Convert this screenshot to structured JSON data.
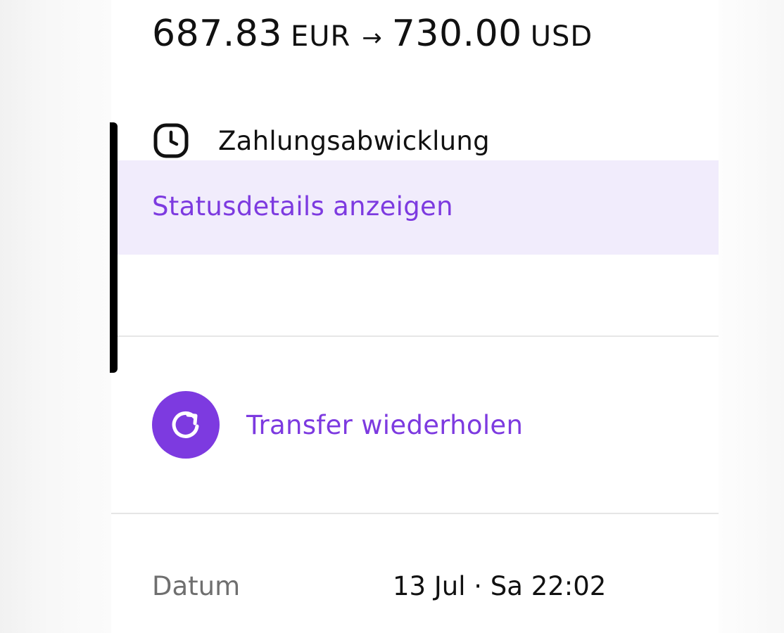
{
  "transfer": {
    "source_amount": "687.83",
    "source_currency": "EUR",
    "arrow": "→",
    "target_amount": "730.00",
    "target_currency": "USD"
  },
  "status": {
    "icon": "clock-icon",
    "label": "Zahlungsabwicklung",
    "details_link": "Statusdetails anzeigen"
  },
  "actions": {
    "repeat_icon": "refresh-icon",
    "repeat_label": "Transfer wiederholen"
  },
  "details": {
    "date_label": "Datum",
    "date_value": "13 Jul · Sa 22:02"
  },
  "colors": {
    "accent": "#7d3ae0",
    "highlight_bg": "#f1ecfc",
    "text": "#111111",
    "muted_text": "#6f6f6f"
  }
}
